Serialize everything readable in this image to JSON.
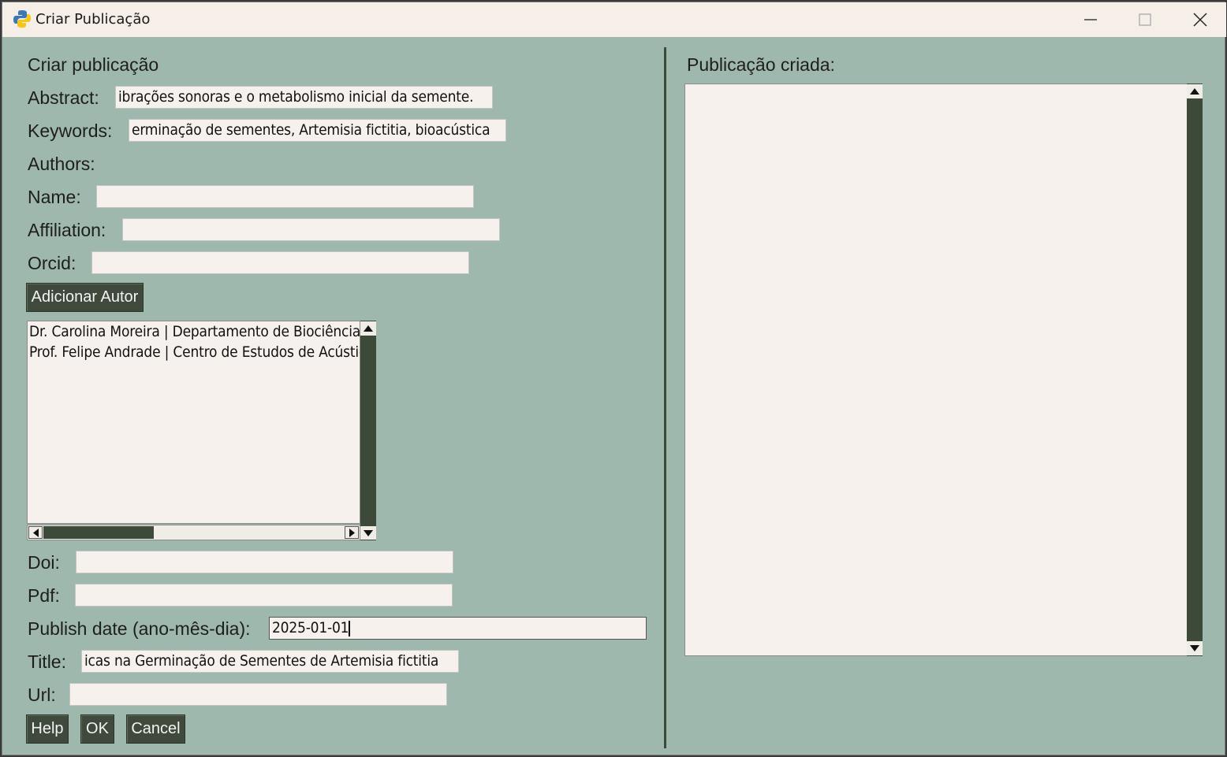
{
  "window": {
    "title": "Criar Publicação",
    "controls": [
      "minimize-icon",
      "maximize-icon",
      "close-icon"
    ]
  },
  "form": {
    "heading": "Criar publicação",
    "abstract": {
      "label": "Abstract:",
      "value": "ibrações sonoras e o metabolismo inicial da semente."
    },
    "keywords": {
      "label": "Keywords:",
      "value": "erminação de sementes, Artemisia fictitia, bioacústica"
    },
    "authors_label": "Authors:",
    "name": {
      "label": "Name:",
      "value": ""
    },
    "affiliation": {
      "label": "Affiliation:",
      "value": ""
    },
    "orcid": {
      "label": "Orcid:",
      "value": ""
    },
    "add_author_button": "Adicionar Autor",
    "authors_list": [
      "Dr. Carolina Moreira | Departamento de Biociências",
      "Prof. Felipe Andrade | Centro de Estudos de Acústica"
    ],
    "doi": {
      "label": "Doi:",
      "value": ""
    },
    "pdf": {
      "label": "Pdf:",
      "value": ""
    },
    "publish_date": {
      "label": "Publish date (ano-mês-dia):",
      "value": "2025-01-01"
    },
    "title": {
      "label": "Title:",
      "value": "icas na Germinação de Sementes de Artemisia fictitia"
    },
    "url": {
      "label": "Url:",
      "value": ""
    },
    "buttons": {
      "help": "Help",
      "ok": "OK",
      "cancel": "Cancel"
    }
  },
  "output": {
    "label": "Publicação criada:",
    "content": ""
  },
  "colors": {
    "background": "#9fb8ad",
    "button": "#3f4a3c",
    "field": "#f6f1ec",
    "titlebar": "#f6efe8"
  }
}
